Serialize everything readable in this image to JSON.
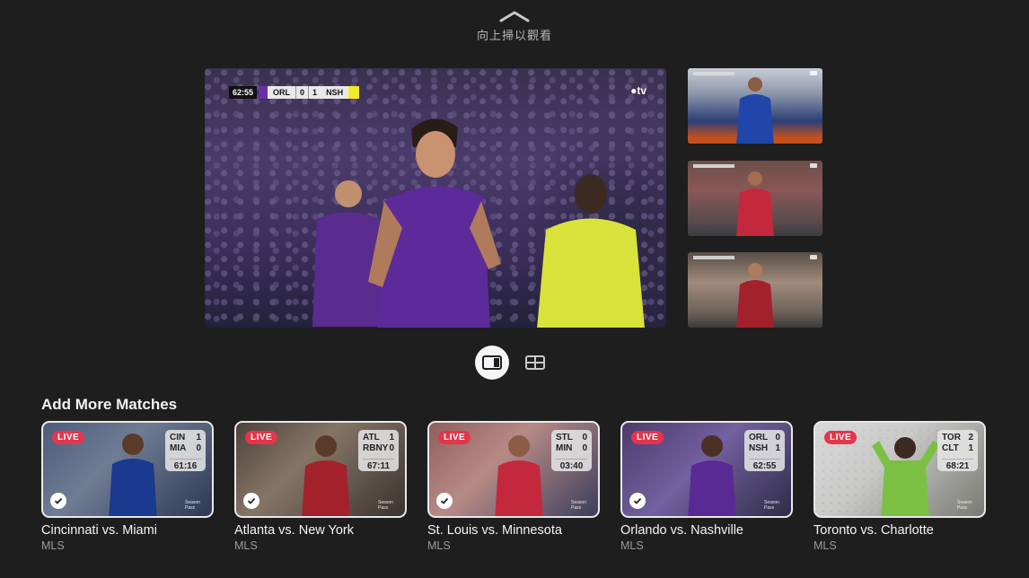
{
  "swipe_hint": {
    "label": "向上掃以觀看",
    "icon": "chevron-up-icon"
  },
  "main_video": {
    "scorebug": {
      "clock": "62:55",
      "home": "ORL",
      "home_score": "0",
      "away_score": "1",
      "away": "NSH",
      "home_color": "#6b2ea8",
      "away_color": "#f3e82b"
    },
    "logo": "tv"
  },
  "layout_toggle": {
    "active": "focus-layout-icon",
    "other": "grid-layout-icon"
  },
  "section_title": "Add More Matches",
  "matches": [
    {
      "title": "Cincinnati vs. Miami",
      "league": "MLS",
      "live": "LIVE",
      "team1": "CIN",
      "score1": "1",
      "team2": "MIA",
      "score2": "0",
      "clock": "61:16",
      "selected": true,
      "kit": "#1a3a8f"
    },
    {
      "title": "Atlanta vs. New York",
      "league": "MLS",
      "live": "LIVE",
      "team1": "ATL",
      "score1": "1",
      "team2": "RBNY",
      "score2": "0",
      "clock": "67:11",
      "selected": true,
      "kit": "#a3212b"
    },
    {
      "title": "St. Louis vs. Minnesota",
      "league": "MLS",
      "live": "LIVE",
      "team1": "STL",
      "score1": "0",
      "team2": "MIN",
      "score2": "0",
      "clock": "03:40",
      "selected": true,
      "kit": "#c4283d"
    },
    {
      "title": "Orlando vs. Nashville",
      "league": "MLS",
      "live": "LIVE",
      "team1": "ORL",
      "score1": "0",
      "team2": "NSH",
      "score2": "1",
      "clock": "62:55",
      "selected": true,
      "kit": "#5a2a94"
    },
    {
      "title": "Toronto vs. Charlotte",
      "league": "MLS",
      "live": "LIVE",
      "team1": "TOR",
      "score1": "2",
      "team2": "CLT",
      "score2": "1",
      "clock": "68:21",
      "selected": false,
      "kit": "#7bc043"
    }
  ]
}
